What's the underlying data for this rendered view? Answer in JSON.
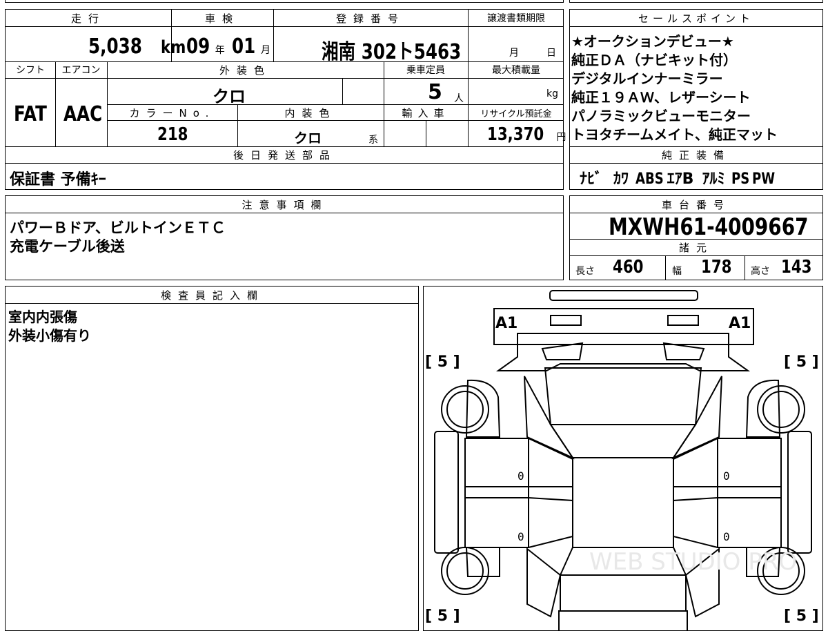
{
  "top_table": {
    "mileage_label": "走行",
    "mileage_value": "5,038",
    "mileage_unit": "km",
    "inspection_label": "車検",
    "inspection_year": "09",
    "inspection_year_unit": "年",
    "inspection_month": "01",
    "inspection_month_unit": "月",
    "registration_label": "登録番号",
    "registration_value": "湘南 302ト5463",
    "transfer_label": "譲渡書類期限",
    "transfer_month_unit": "月",
    "transfer_day_unit": "日",
    "shift_label": "シフト",
    "shift_value": "FAT",
    "aircon_label": "エアコン",
    "aircon_value": "AAC",
    "exterior_label": "外装色",
    "exterior_value": "クロ",
    "capacity_label": "乗車定員",
    "capacity_value": "5",
    "capacity_unit": "人",
    "load_label": "最大積載量",
    "load_unit": "kg",
    "color_no_label": "カラーNo.",
    "color_no_value": "218",
    "interior_label": "内装色",
    "interior_value": "クロ",
    "interior_unit": "系",
    "import_label": "輸入車",
    "recycle_label": "リサイクル預託金",
    "recycle_value": "13,370",
    "recycle_unit": "円",
    "later_parts_label": "後日発送部品",
    "later_parts_value": "保証書 予備ｷｰ"
  },
  "sales_points": {
    "label": "セールスポイント",
    "lines": [
      "★オークションデビュー★",
      "純正ＤＡ（ナビキット付）",
      "デジタルインナーミラー",
      "純正１９ＡＷ、レザーシート",
      "パノラミックビューモニター",
      "トヨタチームメイト、純正マット"
    ]
  },
  "equipment": {
    "label": "純正装備",
    "items": [
      "ﾅﾋﾞ",
      "ｶﾜ",
      "ABS",
      "ｴｱB",
      "ｱﾙﾐ",
      "PS",
      "PW"
    ]
  },
  "notes": {
    "label": "注意事項欄",
    "lines": [
      "パワーＢドア、ビルトインＥＴＣ",
      "充電ケーブル後送"
    ]
  },
  "chassis": {
    "label": "車台番号",
    "value": "MXWH61-4009667",
    "spec_label": "諸元",
    "length_label": "長さ",
    "length_value": "460",
    "width_label": "幅",
    "width_value": "178",
    "height_label": "高さ",
    "height_value": "143"
  },
  "inspector": {
    "label": "検査員記入欄",
    "lines": [
      "室内内張傷",
      "外装小傷有り"
    ]
  },
  "diagram": {
    "a1_left": "A1",
    "a1_right": "A1",
    "tire_fl": "[ 5 ]",
    "tire_fr": "[ 5 ]",
    "tire_rl": "[ 5 ]",
    "tire_rr": "[ 5 ]",
    "door_fl": "0",
    "door_fr": "0",
    "door_rl": "0",
    "door_rr": "0",
    "watermark": "WEB STUDIO PRO"
  }
}
